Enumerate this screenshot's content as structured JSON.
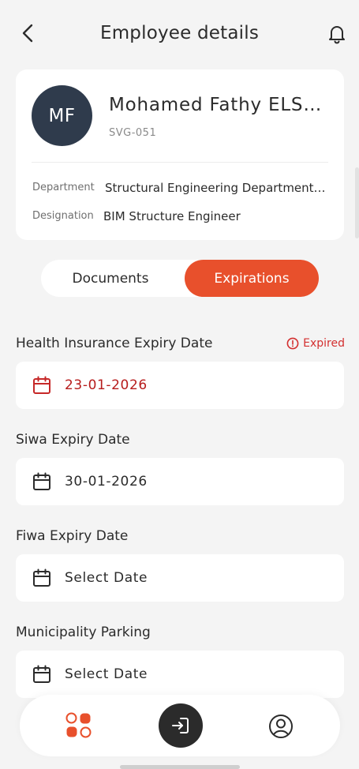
{
  "header": {
    "title": "Employee details",
    "back_icon": "chevron-left-icon",
    "notification_icon": "bell-icon"
  },
  "employee": {
    "initials": "MF",
    "name": "Mohamed   Fathy ELSayed",
    "code": "SVG-051",
    "department_label": "Department",
    "department_value": "Structural Engineering Department - BIM",
    "designation_label": "Designation",
    "designation_value": "BIM Structure Engineer"
  },
  "tabs": {
    "documents": "Documents",
    "expirations": "Expirations",
    "active": "expirations"
  },
  "fields": [
    {
      "label": "Health Insurance Expiry Date",
      "value": "23-01-2026",
      "status": "Expired"
    },
    {
      "label": "Siwa Expiry Date",
      "value": "30-01-2026"
    },
    {
      "label": "Fiwa Expiry Date",
      "value": "Select Date"
    },
    {
      "label": "Municipality Parking",
      "value": "Select Date"
    }
  ],
  "nav": {
    "home_icon": "apps-grid-icon",
    "center_icon": "login-icon",
    "profile_icon": "user-circle-icon"
  },
  "colors": {
    "accent": "#e8502c",
    "expired": "#d32f2f",
    "avatar_bg": "#2f3b4c",
    "background": "#f4f4f4"
  }
}
